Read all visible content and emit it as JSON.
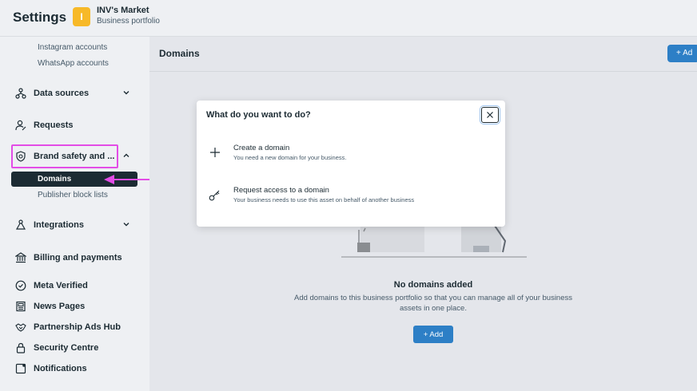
{
  "topbar": {
    "title": "Settings",
    "account_initial": "I",
    "account_name": "INV's Market",
    "account_type": "Business portfolio"
  },
  "sidebar": {
    "sub_top": [
      "Instagram accounts",
      "WhatsApp accounts"
    ],
    "items": [
      {
        "label": "Data sources",
        "icon": "data-sources-icon",
        "chevron": "down"
      },
      {
        "label": "Requests",
        "icon": "requests-icon"
      },
      {
        "label": "Brand safety and ...",
        "icon": "shield-icon",
        "chevron": "up"
      },
      {
        "label": "Integrations",
        "icon": "integrations-icon",
        "chevron": "down"
      },
      {
        "label": "Billing and payments",
        "icon": "bank-icon"
      },
      {
        "label": "Meta Verified",
        "icon": "verified-badge-icon"
      },
      {
        "label": "News Pages",
        "icon": "news-icon"
      },
      {
        "label": "Partnership Ads Hub",
        "icon": "handshake-icon"
      },
      {
        "label": "Security Centre",
        "icon": "lock-icon"
      },
      {
        "label": "Notifications",
        "icon": "notification-icon"
      }
    ],
    "brand_sub": [
      "Domains",
      "Publisher block lists"
    ],
    "active_item": "Domains"
  },
  "main": {
    "title": "Domains",
    "top_add_label": "+ Ad",
    "empty_title": "No domains added",
    "empty_desc": "Add domains to this business portfolio so that you can manage all of your business assets in one place.",
    "add_label": "+ Add"
  },
  "dialog": {
    "title": "What do you want to do?",
    "options": [
      {
        "title": "Create a domain",
        "desc": "You need a new domain for your business.",
        "icon": "plus-icon"
      },
      {
        "title": "Request access to a domain",
        "desc": "Your business needs to use this asset on behalf of another business",
        "icon": "key-icon"
      }
    ]
  },
  "colors": {
    "accent": "#2d7fc6",
    "highlight": "#e34ce6",
    "badge": "#f7b928",
    "active": "#1c2b33"
  }
}
